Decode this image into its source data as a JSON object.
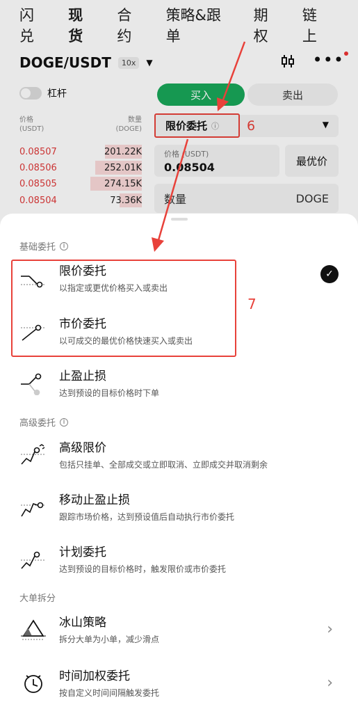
{
  "tabs": [
    "闪兑",
    "现货",
    "合约",
    "策略&跟单",
    "期权",
    "链上"
  ],
  "active_tab": "现货",
  "pair": "DOGE/USDT",
  "leverage_badge": "10x",
  "margin_toggle_label": "杠杆",
  "buy_label": "买入",
  "sell_label": "卖出",
  "orderbook": {
    "price_header": "价格\n(USDT)",
    "qty_header": "数量\n(DOGE)",
    "rows": [
      {
        "price": "0.08507",
        "qty": "201.22K",
        "depth": 0.3
      },
      {
        "price": "0.08506",
        "qty": "252.01K",
        "depth": 0.38
      },
      {
        "price": "0.08505",
        "qty": "274.15K",
        "depth": 0.42
      },
      {
        "price": "0.08504",
        "qty": "73.36K",
        "depth": 0.18
      }
    ]
  },
  "order_type_selected": "限价委托",
  "price_label": "价格 (USDT)",
  "price_value": "0.08504",
  "best_price_label": "最优价",
  "qty_label": "数量",
  "qty_unit": "DOGE",
  "annotations": {
    "step6": "6",
    "step7": "7"
  },
  "sheet": {
    "section_basic": "基础委托",
    "section_advanced": "高级委托",
    "section_large": "大单拆分",
    "items": {
      "limit": {
        "title": "限价委托",
        "desc": "以指定或更优价格买入或卖出"
      },
      "market": {
        "title": "市价委托",
        "desc": "以可成交的最优价格快速买入或卖出"
      },
      "tpsl": {
        "title": "止盈止损",
        "desc": "达到预设的目标价格时下单"
      },
      "adv_limit": {
        "title": "高级限价",
        "desc": "包括只挂单、全部成交或立即取消、立即成交并取消剩余"
      },
      "trailing": {
        "title": "移动止盈止损",
        "desc": "跟踪市场价格，达到预设值后自动执行市价委托"
      },
      "trigger": {
        "title": "计划委托",
        "desc": "达到预设的目标价格时，触发限价或市价委托"
      },
      "iceberg": {
        "title": "冰山策略",
        "desc": "拆分大单为小单，减少滑点"
      },
      "twap": {
        "title": "时间加权委托",
        "desc": "按自定义时间间隔触发委托"
      }
    }
  }
}
